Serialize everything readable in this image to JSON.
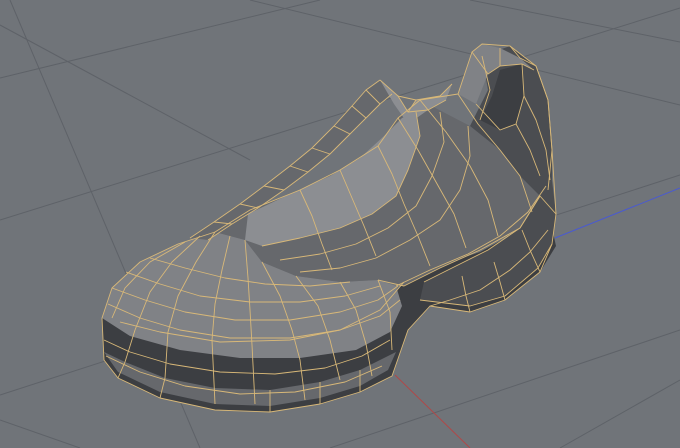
{
  "viewport": {
    "background_color": "#707479",
    "grid_color": "#5e6268",
    "wireframe_color": "#d8b878",
    "axis_x_color": "#b04848",
    "axis_z_color": "#4a5ad0",
    "display_mode": "shaded-wireframe",
    "object": "shoe-mesh"
  }
}
